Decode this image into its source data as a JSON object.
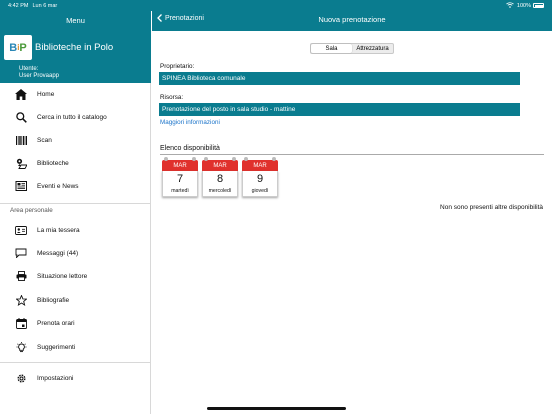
{
  "status_bar": {
    "time": "4:42 PM",
    "date": "Lun 6 mar",
    "battery": "100%"
  },
  "sidebar": {
    "title": "Menu",
    "logo_letters": {
      "b": "B",
      "i": "i",
      "p": "P"
    },
    "brand": "Biblioteche in Polo",
    "user_label": "Utente:",
    "user_name": "User Provaapp",
    "section_label": "Area personale",
    "items": [
      {
        "label": "Home",
        "icon": "home-icon"
      },
      {
        "label": "Cerca in tutto il catalogo",
        "icon": "search-icon"
      },
      {
        "label": "Scan",
        "icon": "barcode-icon"
      },
      {
        "label": "Biblioteche",
        "icon": "map-pin-icon"
      },
      {
        "label": "Eventi e News",
        "icon": "news-icon"
      },
      {
        "label": "La mia tessera",
        "icon": "id-card-icon"
      },
      {
        "label": "Messaggi (44)",
        "icon": "message-icon"
      },
      {
        "label": "Situazione lettore",
        "icon": "printer-icon"
      },
      {
        "label": "Bibliografie",
        "icon": "star-icon"
      },
      {
        "label": "Prenota orari",
        "icon": "calendar-icon"
      },
      {
        "label": "Suggerimenti",
        "icon": "lightbulb-icon"
      },
      {
        "label": "Impostazioni",
        "icon": "gear-icon"
      }
    ]
  },
  "header": {
    "back_label": "Prenotazioni",
    "title": "Nuova prenotazione"
  },
  "segment": {
    "options": [
      "Sala",
      "Attrezzatura"
    ],
    "selected": "Sala"
  },
  "form": {
    "owner_label": "Proprietario:",
    "owner_value": "SPINEA Biblioteca comunale",
    "resource_label": "Risorsa:",
    "resource_value": "Prenotazione del posto in sala studio - mattine",
    "more_info_link": "Maggiori informazioni"
  },
  "availability": {
    "title": "Elenco disponibilità",
    "days": [
      {
        "month": "MAR",
        "day": "7",
        "weekday": "martedì"
      },
      {
        "month": "MAR",
        "day": "8",
        "weekday": "mercoledì"
      },
      {
        "month": "MAR",
        "day": "9",
        "weekday": "giovedì"
      }
    ],
    "no_more_text": "Non sono presenti altre disponibilità"
  },
  "colors": {
    "brand": "#0a7c8f",
    "calendar_red": "#e0312d",
    "link": "#1a73c9"
  }
}
